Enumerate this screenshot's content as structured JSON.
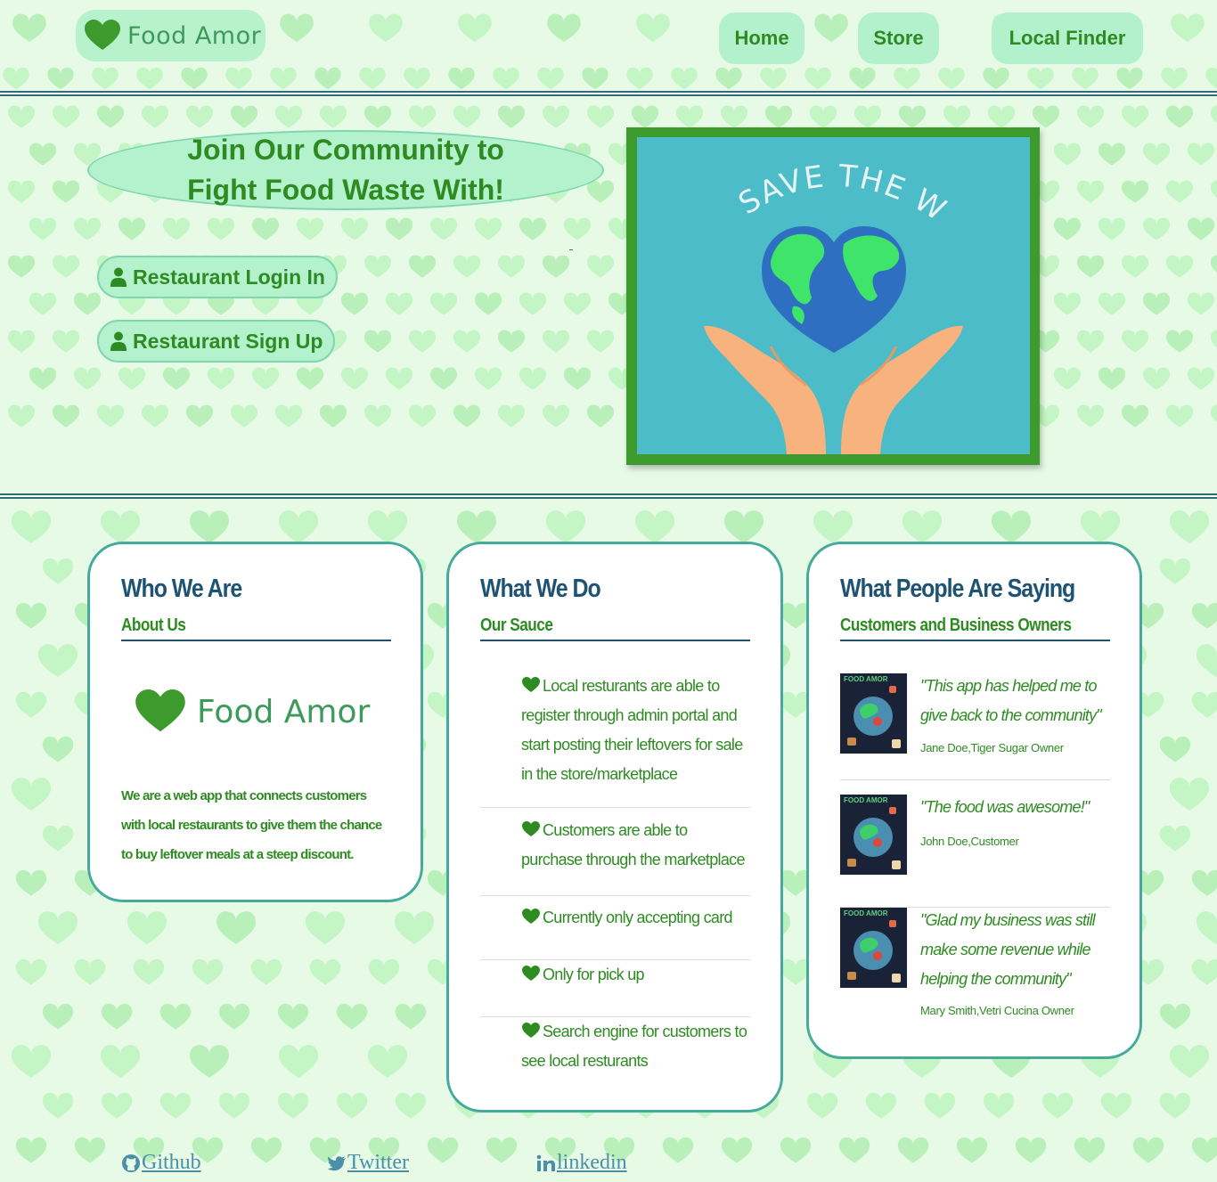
{
  "nav": {
    "logo_text": "Food Amor",
    "links": [
      "Home",
      "Store",
      "Local Finder"
    ]
  },
  "hero": {
    "title_line1": "Join Our Community to",
    "title_line2": "Fight Food Waste With!",
    "login_label": "Restaurant Login In",
    "signup_label": "Restaurant Sign Up",
    "image_text": "SAVE THE WORLD"
  },
  "who": {
    "title": "Who We Are",
    "subtitle": "About Us",
    "logo_text": "Food Amor",
    "body": "We are a web app that connects customers with local restaurants to give them the chance to buy leftover meals at a steep discount."
  },
  "what": {
    "title": "What We Do",
    "subtitle": "Our Sauce",
    "items": [
      "Local resturants are able to register through admin portal and start posting their leftovers for sale in the store/marketplace",
      "Customers are able to purchase through the marketplace",
      "Currently only accepting card",
      "Only for pick up",
      "Search engine for customers to see local resturants"
    ]
  },
  "saying": {
    "title": "What People Are Saying",
    "subtitle": "Customers and Business Owners",
    "thumb_text": "FOOD AMOR",
    "reviews": [
      {
        "quote": "\"This app has helped me to give back to the community\"",
        "author": "Jane Doe,Tiger Sugar Owner"
      },
      {
        "quote": "\"The food was awesome!\"",
        "author": "John Doe,Customer"
      },
      {
        "quote": "\"Glad my business was still make some revenue while helping the community\"",
        "author": "Mary Smith,Vetri Cucina Owner"
      }
    ]
  },
  "footer": {
    "github": "Github",
    "twitter": "Twitter",
    "linkedin": "linkedin"
  },
  "colors": {
    "background": "#e6fae6",
    "heart": "#c4f5c4",
    "accent_green": "#2e8b22",
    "navy": "#1e5374",
    "teal_border": "#45aa9c"
  }
}
